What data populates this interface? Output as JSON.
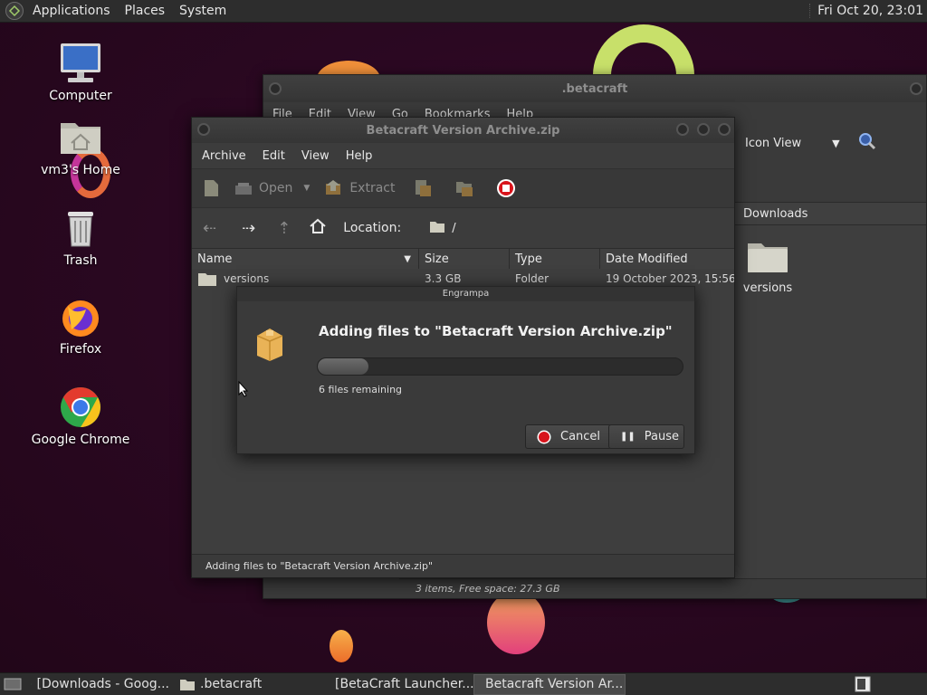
{
  "top_panel": {
    "menus": [
      "Applications",
      "Places",
      "System"
    ],
    "clock": "Fri Oct 20, 23:01"
  },
  "desktop": {
    "icons": [
      {
        "label": "Computer",
        "icon": "computer-icon"
      },
      {
        "label": "vm3's Home",
        "icon": "home-folder-icon"
      },
      {
        "label": "Trash",
        "icon": "trash-icon"
      },
      {
        "label": "Firefox",
        "icon": "firefox-icon"
      },
      {
        "label": "Google Chrome",
        "icon": "chrome-icon"
      }
    ]
  },
  "back_window": {
    "title": ".betacraft",
    "menus": [
      "File",
      "Edit",
      "View",
      "Go",
      "Bookmarks",
      "Help"
    ],
    "view_mode": "Icon View",
    "path_label": "Downloads",
    "item_label": "versions",
    "status": "3 items, Free space: 27.3 GB"
  },
  "archive_window": {
    "title": "Betacraft Version Archive.zip",
    "menus": [
      "Archive",
      "Edit",
      "View",
      "Help"
    ],
    "toolbar": {
      "open_label": "Open",
      "extract_label": "Extract"
    },
    "location_label": "Location:",
    "location_value": "/",
    "columns": {
      "name": "Name",
      "size": "Size",
      "type": "Type",
      "modified": "Date Modified"
    },
    "rows": [
      {
        "name": "versions",
        "size": "3.3 GB",
        "type": "Folder",
        "modified": "19 October 2023, 15:56"
      }
    ],
    "status": "Adding files to \"Betacraft Version Archive.zip\""
  },
  "dialog": {
    "title": "Engrampa",
    "heading": "Adding files to \"Betacraft Version Archive.zip\"",
    "remaining": "6 files remaining",
    "progress": 0.14,
    "cancel_label": "Cancel",
    "pause_label": "Pause"
  },
  "taskbar": {
    "tasks": [
      {
        "label": "[Downloads - Goog...",
        "icon": "chrome-icon",
        "active": false
      },
      {
        "label": ".betacraft",
        "icon": "folder-icon",
        "active": false
      },
      {
        "label": "[BetaCraft Launcher...",
        "icon": "java-icon",
        "active": false
      },
      {
        "label": "Betacraft Version Ar...",
        "icon": "archive-icon",
        "active": true
      }
    ]
  },
  "colors": {
    "cancel_red": "#d8141c",
    "folder": "#d9d5c7",
    "archive_box": "#e9b357"
  }
}
